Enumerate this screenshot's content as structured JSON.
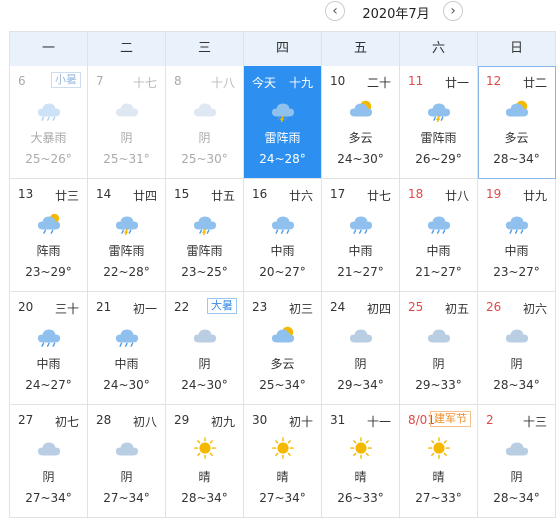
{
  "nav": {
    "title": "2020年7月",
    "prev_symbol": "‹",
    "next_symbol": "›"
  },
  "weekdays": [
    "一",
    "二",
    "三",
    "四",
    "五",
    "六",
    "日"
  ],
  "today_label": "今天",
  "days": [
    {
      "day": "6",
      "lunar": "",
      "tag": "小暑",
      "tag_color": "blue",
      "icon": "heavy-rain-icon",
      "cond": "大暴雨",
      "temp": "25~26°",
      "past": true
    },
    {
      "day": "7",
      "lunar": "十七",
      "icon": "cloudy-icon",
      "cond": "阴",
      "temp": "25~31°",
      "past": true
    },
    {
      "day": "8",
      "lunar": "十八",
      "icon": "cloudy-icon",
      "cond": "阴",
      "temp": "25~30°",
      "past": true
    },
    {
      "day": "今天",
      "lunar": "十九",
      "icon": "thunder-rain-icon",
      "cond": "雷阵雨",
      "temp": "24~28°",
      "today": true
    },
    {
      "day": "10",
      "lunar": "二十",
      "icon": "partly-cloudy-icon",
      "cond": "多云",
      "temp": "24~30°"
    },
    {
      "day": "11",
      "lunar": "廿一",
      "icon": "thunder-rain-icon",
      "cond": "雷阵雨",
      "temp": "26~29°",
      "weekend": true
    },
    {
      "day": "12",
      "lunar": "廿二",
      "icon": "partly-cloudy-icon",
      "cond": "多云",
      "temp": "28~34°",
      "weekend": true,
      "selected": true
    },
    {
      "day": "13",
      "lunar": "廿三",
      "icon": "shower-icon",
      "cond": "阵雨",
      "temp": "23~29°"
    },
    {
      "day": "14",
      "lunar": "廿四",
      "icon": "thunder-rain-icon",
      "cond": "雷阵雨",
      "temp": "22~28°"
    },
    {
      "day": "15",
      "lunar": "廿五",
      "icon": "thunder-rain-icon",
      "cond": "雷阵雨",
      "temp": "23~25°"
    },
    {
      "day": "16",
      "lunar": "廿六",
      "icon": "rain-icon",
      "cond": "中雨",
      "temp": "20~27°"
    },
    {
      "day": "17",
      "lunar": "廿七",
      "icon": "rain-icon",
      "cond": "中雨",
      "temp": "21~27°"
    },
    {
      "day": "18",
      "lunar": "廿八",
      "icon": "rain-icon",
      "cond": "中雨",
      "temp": "21~27°",
      "weekend": true
    },
    {
      "day": "19",
      "lunar": "廿九",
      "icon": "rain-icon",
      "cond": "中雨",
      "temp": "23~27°",
      "weekend": true
    },
    {
      "day": "20",
      "lunar": "三十",
      "icon": "rain-icon",
      "cond": "中雨",
      "temp": "24~27°"
    },
    {
      "day": "21",
      "lunar": "初一",
      "icon": "rain-icon",
      "cond": "中雨",
      "temp": "24~30°"
    },
    {
      "day": "22",
      "lunar": "",
      "tag": "大暑",
      "tag_color": "blue",
      "icon": "cloudy-icon",
      "cond": "阴",
      "temp": "24~30°"
    },
    {
      "day": "23",
      "lunar": "初三",
      "icon": "partly-cloudy-icon",
      "cond": "多云",
      "temp": "25~34°"
    },
    {
      "day": "24",
      "lunar": "初四",
      "icon": "cloudy-icon",
      "cond": "阴",
      "temp": "29~34°"
    },
    {
      "day": "25",
      "lunar": "初五",
      "icon": "cloudy-icon",
      "cond": "阴",
      "temp": "29~33°",
      "weekend": true
    },
    {
      "day": "26",
      "lunar": "初六",
      "icon": "cloudy-icon",
      "cond": "阴",
      "temp": "28~34°",
      "weekend": true
    },
    {
      "day": "27",
      "lunar": "初七",
      "icon": "cloudy-icon",
      "cond": "阴",
      "temp": "27~34°"
    },
    {
      "day": "28",
      "lunar": "初八",
      "icon": "cloudy-icon",
      "cond": "阴",
      "temp": "27~34°"
    },
    {
      "day": "29",
      "lunar": "初九",
      "icon": "sunny-icon",
      "cond": "晴",
      "temp": "28~34°"
    },
    {
      "day": "30",
      "lunar": "初十",
      "icon": "sunny-icon",
      "cond": "晴",
      "temp": "27~34°"
    },
    {
      "day": "31",
      "lunar": "十一",
      "icon": "sunny-icon",
      "cond": "晴",
      "temp": "26~33°"
    },
    {
      "day": "8/01",
      "lunar": "",
      "tag": "建军节",
      "tag_color": "orange",
      "icon": "sunny-icon",
      "cond": "晴",
      "temp": "27~33°",
      "weekend": true
    },
    {
      "day": "2",
      "lunar": "十三",
      "icon": "cloudy-icon",
      "cond": "阴",
      "temp": "28~34°",
      "weekend": true
    }
  ],
  "colors": {
    "today_bg": "#2d8ff0",
    "header_bg": "#e9f1fb",
    "weekend": "#e04848",
    "sun": "#f5b800",
    "cloud": "#b9cde3",
    "rain_cloud": "#8fc0ee"
  }
}
